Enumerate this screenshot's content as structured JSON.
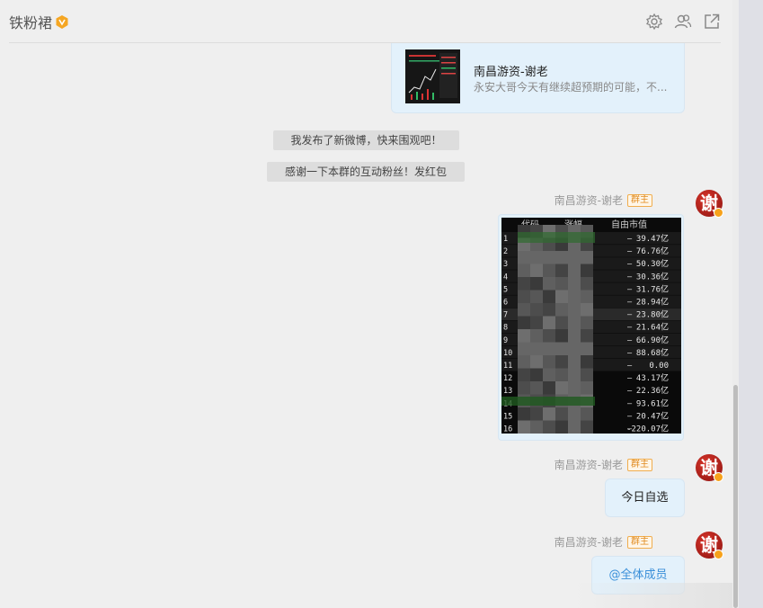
{
  "header": {
    "title": "铁粉裙",
    "icons": [
      "settings-icon",
      "members-icon",
      "popout-icon"
    ]
  },
  "link_card": {
    "title": "南昌游资-谢老",
    "desc": "永安大哥今天有继续超预期的可能，不..."
  },
  "system_messages": [
    "我发布了新微博，快来围观吧！",
    "感谢一下本群的互动粉丝！发红包"
  ],
  "messages": [
    {
      "sender": "南昌游资-谢老",
      "role": "群主",
      "type": "image"
    },
    {
      "sender": "南昌游资-谢老",
      "role": "群主",
      "type": "text",
      "text": "今日自选"
    },
    {
      "sender": "南昌游资-谢老",
      "role": "群主",
      "type": "text",
      "text": "@全体成员"
    }
  ],
  "avatar_char": "谢",
  "stock_table": {
    "headers": [
      "代码",
      "涨幅",
      "自由市值"
    ],
    "rows": [
      {
        "no": "1",
        "change": "—",
        "value": "39.47亿"
      },
      {
        "no": "2",
        "change": "—",
        "value": "76.76亿"
      },
      {
        "no": "3",
        "change": "—",
        "value": "50.30亿"
      },
      {
        "no": "4",
        "change": "—",
        "value": "30.36亿"
      },
      {
        "no": "5",
        "change": "—",
        "value": "31.76亿"
      },
      {
        "no": "6",
        "change": "—",
        "value": "28.94亿"
      },
      {
        "no": "7",
        "change": "—",
        "value": "23.80亿"
      },
      {
        "no": "8",
        "change": "—",
        "value": "21.64亿"
      },
      {
        "no": "9",
        "change": "—",
        "value": "66.90亿"
      },
      {
        "no": "10",
        "change": "—",
        "value": "88.68亿"
      },
      {
        "no": "11",
        "change": "—",
        "value": "0.00"
      },
      {
        "no": "12",
        "change": "—",
        "value": "43.17亿"
      },
      {
        "no": "13",
        "change": "—",
        "value": "22.36亿"
      },
      {
        "no": "14",
        "change": "—",
        "value": "93.61亿"
      },
      {
        "no": "15",
        "change": "—",
        "value": "20.47亿"
      },
      {
        "no": "16",
        "change": "—",
        "value": "-220.07亿"
      }
    ]
  },
  "colors": {
    "bubble_bg": "#e3f1fb",
    "role_badge": "#e08a1e",
    "mention": "#3a8fd9",
    "avatar": "#c0221a"
  }
}
